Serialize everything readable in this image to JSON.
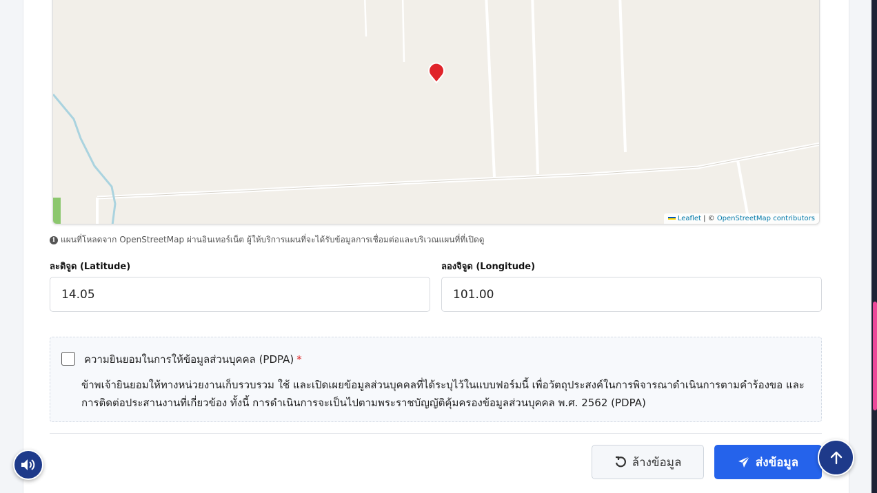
{
  "map": {
    "attribution_leaflet": "Leaflet",
    "attribution_sep": " | © ",
    "attribution_osm": "OpenStreetMap contributors",
    "note": "แผนที่โหลดจาก OpenStreetMap ผ่านอินเทอร์เน็ต ผู้ให้บริการแผนที่จะได้รับข้อมูลการเชื่อมต่อและบริเวณแผนที่ที่เปิดดู",
    "marker_icon": "map-pin-icon"
  },
  "fields": {
    "latitude_label": "ละติจูด (Latitude)",
    "latitude_value": "14.05",
    "longitude_label": "ลองจิจูด (Longitude)",
    "longitude_value": "101.00"
  },
  "consent": {
    "title": "ความยินยอมในการให้ข้อมูลส่วนบุคคล (PDPA)",
    "required_mark": "*",
    "body": "ข้าพเจ้ายินยอมให้ทางหน่วยงานเก็บรวบรวม ใช้ และเปิดเผยข้อมูลส่วนบุคคลที่ได้ระบุไว้ในแบบฟอร์มนี้ เพื่อวัตถุประสงค์ในการพิจารณาดำเนินการตามคำร้องขอ และการติดต่อประสานงานที่เกี่ยวข้อง ทั้งนี้ การดำเนินการจะเป็นไปตามพระราชบัญญัติคุ้มครองข้อมูลส่วนบุคคล พ.ศ. 2562 (PDPA)",
    "checked": false
  },
  "actions": {
    "reset_label": "ล้างข้อมูล",
    "submit_label": "ส่งข้อมูล"
  },
  "colors": {
    "primary": "#2563eb",
    "fab": "#1e3a8a",
    "required": "#dc2626",
    "scroll_thumb": "#ec4899",
    "marker": "#e0242a"
  }
}
